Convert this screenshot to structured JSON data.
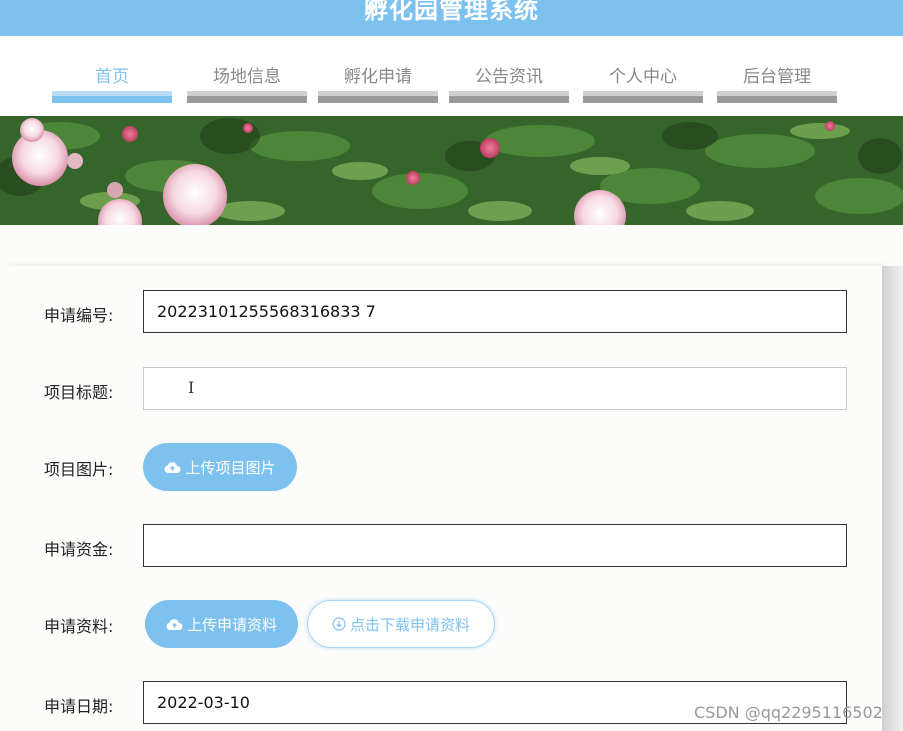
{
  "header": {
    "title": "孵化园管理系统"
  },
  "nav": {
    "items": [
      {
        "label": "首页",
        "active": true
      },
      {
        "label": "场地信息",
        "active": false
      },
      {
        "label": "孵化申请",
        "active": false
      },
      {
        "label": "公告资讯",
        "active": false
      },
      {
        "label": "个人中心",
        "active": false
      },
      {
        "label": "后台管理",
        "active": false
      }
    ]
  },
  "form": {
    "application_no": {
      "label": "申请编号:",
      "value": "20223101255568316833 7"
    },
    "project_title": {
      "label": "项目标题:",
      "value": ""
    },
    "project_image": {
      "label": "项目图片:",
      "button": "上传项目图片"
    },
    "funding": {
      "label": "申请资金:",
      "value": ""
    },
    "materials": {
      "label": "申请资料:",
      "upload_button": "上传申请资料",
      "download_button": "点击下载申请资料"
    },
    "date": {
      "label": "申请日期:",
      "value": "2022-03-10"
    }
  },
  "colors": {
    "accent": "#7dc1ef",
    "nav_inactive": "#9a9a9a"
  },
  "watermark": "CSDN @qq2295116502"
}
